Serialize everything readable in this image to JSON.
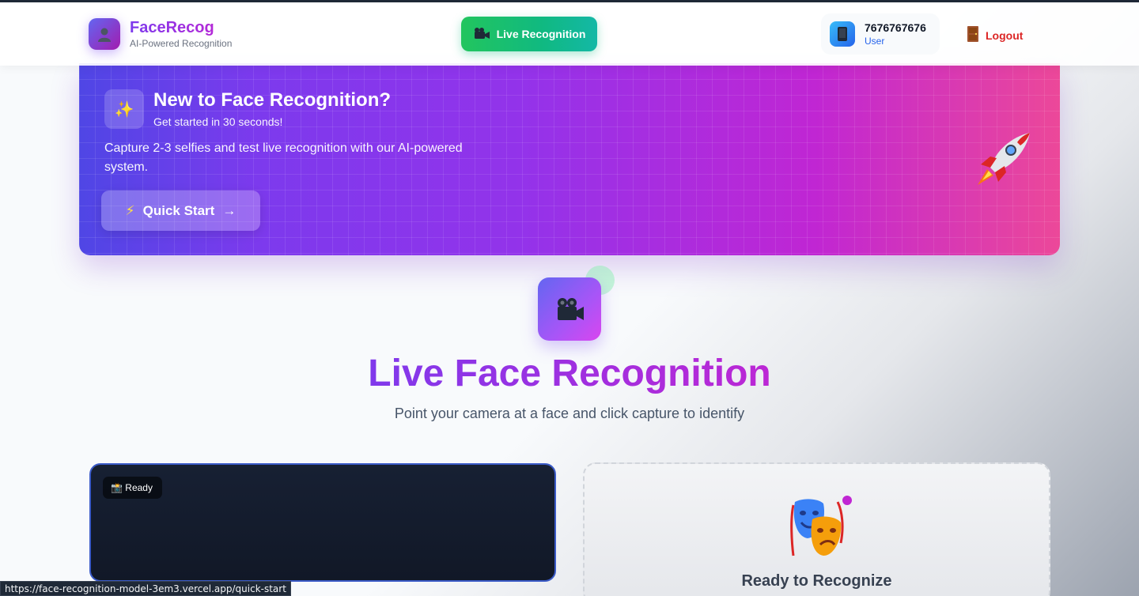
{
  "header": {
    "brand_name": "FaceRecog",
    "brand_sub": "AI-Powered Recognition",
    "live_button_label": "Live Recognition",
    "user_phone": "7676767676",
    "user_role": "User",
    "logout_label": "Logout"
  },
  "banner": {
    "title": "New to Face Recognition?",
    "subtitle": "Get started in 30 seconds!",
    "description": "Capture 2-3 selfies and test live recognition with our AI-powered system.",
    "quick_start_label": "Quick Start",
    "sparkle_glyph": "✨",
    "bolt_glyph": "⚡",
    "arrow_glyph": "→"
  },
  "main": {
    "title": "Live Face Recognition",
    "subtitle": "Point your camera at a face and click capture to identify"
  },
  "camera": {
    "status_label": "📸 Ready"
  },
  "result": {
    "title": "Ready to Recognize"
  },
  "status_bar": {
    "url": "https://face-recognition-model-3em3.vercel.app/quick-start"
  },
  "colors": {
    "brand_purple": "#7c3aed",
    "brand_magenta": "#c026d3",
    "live_green": "#10b981",
    "logout_red": "#dc2626",
    "user_blue": "#2563eb"
  },
  "icons": {
    "brand": "person-silhouette-icon",
    "live": "movie-camera-icon",
    "user": "mobile-phone-icon",
    "logout": "door-icon",
    "banner": "sparkles-icon",
    "quick_start": "lightning-icon",
    "decor": "rocket-icon",
    "hero": "movie-camera-icon",
    "result": "performing-arts-masks-icon"
  }
}
